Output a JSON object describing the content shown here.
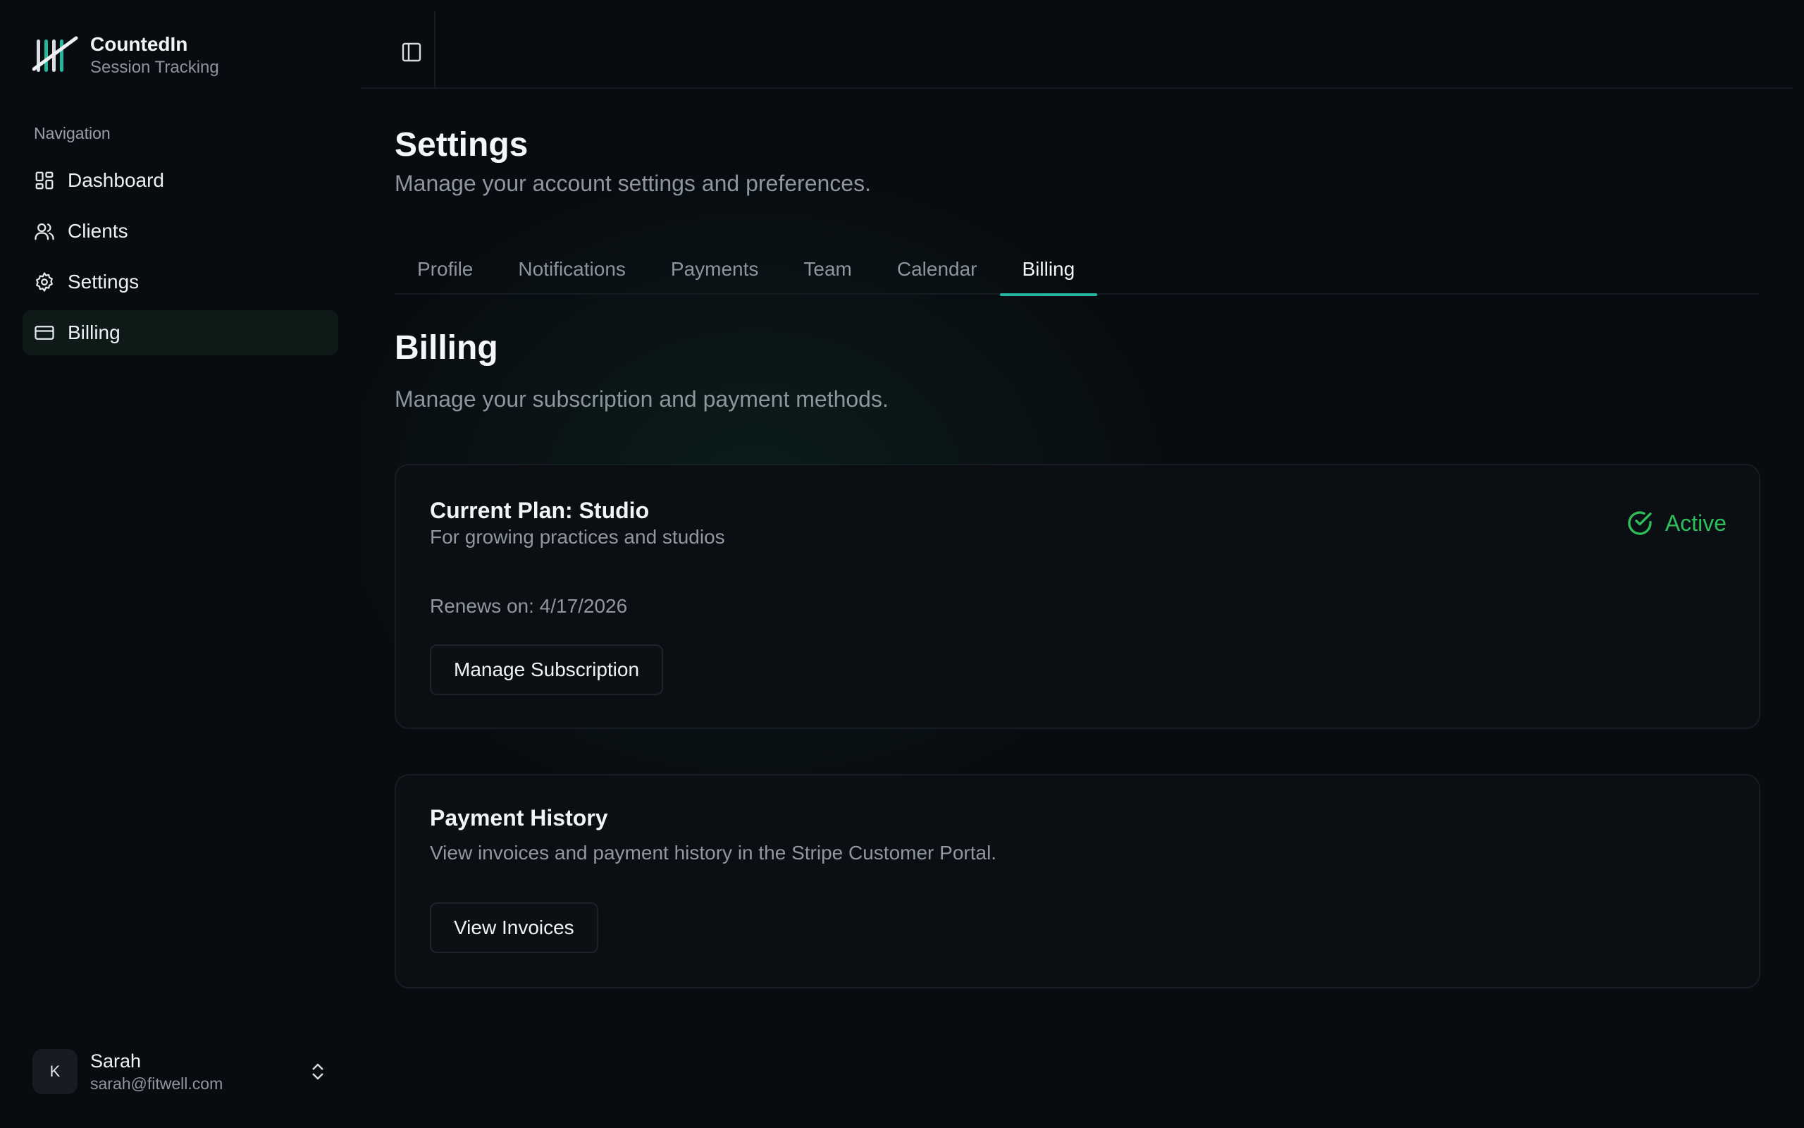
{
  "app": {
    "name": "CountedIn",
    "subtitle": "Session Tracking"
  },
  "sidebar": {
    "section_label": "Navigation",
    "items": [
      {
        "label": "Dashboard",
        "icon": "dashboard-icon"
      },
      {
        "label": "Clients",
        "icon": "users-icon"
      },
      {
        "label": "Settings",
        "icon": "gear-icon"
      },
      {
        "label": "Billing",
        "icon": "credit-card-icon",
        "active": true
      }
    ]
  },
  "user": {
    "initial": "K",
    "name": "Sarah",
    "email": "sarah@fitwell.com"
  },
  "page": {
    "title": "Settings",
    "subtitle": "Manage your account settings and preferences."
  },
  "tabs": [
    {
      "label": "Profile"
    },
    {
      "label": "Notifications"
    },
    {
      "label": "Payments"
    },
    {
      "label": "Team"
    },
    {
      "label": "Calendar"
    },
    {
      "label": "Billing",
      "active": true
    }
  ],
  "billing": {
    "title": "Billing",
    "subtitle": "Manage your subscription and payment methods.",
    "plan": {
      "title": "Current Plan: Studio",
      "description": "For growing practices and studios",
      "status": "Active",
      "renews": "Renews on: 4/17/2026",
      "button_label": "Manage Subscription"
    },
    "history": {
      "title": "Payment History",
      "description": "View invoices and payment history in the Stripe Customer Portal.",
      "button_label": "View Invoices"
    }
  },
  "colors": {
    "accent": "#25b89e",
    "status_active": "#2fbf5a",
    "background": "#080b10"
  }
}
